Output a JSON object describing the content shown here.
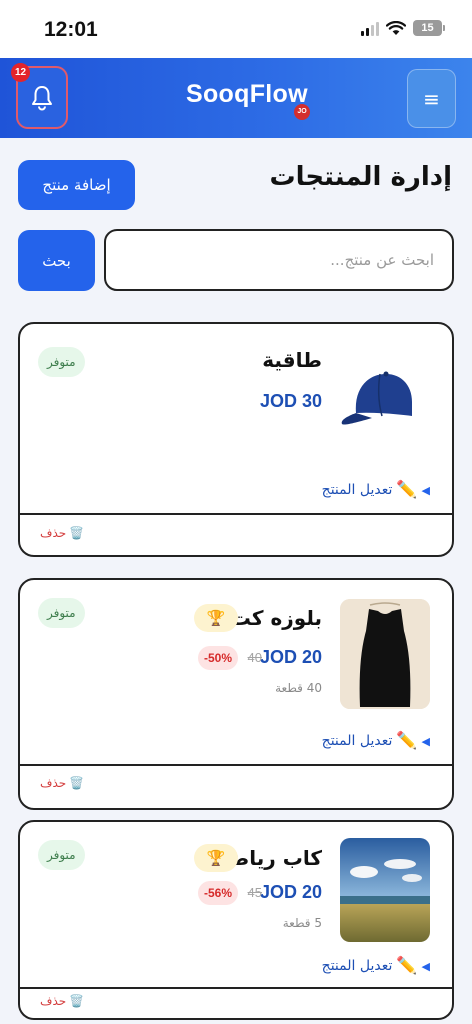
{
  "status_bar": {
    "time": "12:01",
    "battery": "15"
  },
  "header": {
    "brand": "SooqFlow",
    "brand_badge": "JO",
    "notifications_count": "12"
  },
  "page": {
    "title": "إدارة المنتجات",
    "add_button": "إضافة منتج"
  },
  "search": {
    "placeholder": "ابحث عن منتج...",
    "value": "",
    "button": "بحث"
  },
  "products": [
    {
      "name": "طاقية",
      "price": "JOD 30",
      "status": "متوفر",
      "edit_label": "تعديل المنتج",
      "delete_label": "حذف",
      "image_icon": "cap-icon"
    },
    {
      "name": "بلوزه كت",
      "price": "JOD 20",
      "old_price": "40",
      "discount": "-50%",
      "quantity": "40 قطعة",
      "status": "متوفر",
      "edit_label": "تعديل المنتج",
      "delete_label": "حذف",
      "image_icon": "black-top-icon"
    },
    {
      "name": "كاب رياضي",
      "price": "JOD 20",
      "old_price": "45",
      "discount": "-56%",
      "quantity": "5 قطعة",
      "status": "متوفر",
      "edit_label": "تعديل المنتج",
      "delete_label": "حذف",
      "image_icon": "landscape-photo-icon"
    }
  ],
  "colors": {
    "primary": "#2463eb",
    "header_start": "#1f54d8",
    "price": "#1d4fb4",
    "discount": "#d62b2b",
    "status_bg": "#e6f7ea",
    "delete": "#d33c3c"
  }
}
